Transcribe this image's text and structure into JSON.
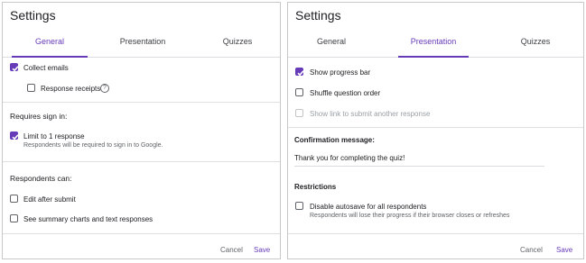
{
  "left": {
    "title": "Settings",
    "tabs": [
      "General",
      "Presentation",
      "Quizzes"
    ],
    "collect_emails": "Collect emails",
    "response_receipts": "Response receipts",
    "help_glyph": "?",
    "requires_sign_in": "Requires sign in:",
    "limit_one": "Limit to 1 response",
    "limit_one_sub": "Respondents will be required to sign in to Google.",
    "respondents_can": "Respondents can:",
    "edit_after_submit": "Edit after submit",
    "see_summary": "See summary charts and text responses",
    "cancel": "Cancel",
    "save": "Save"
  },
  "right": {
    "title": "Settings",
    "tabs": [
      "General",
      "Presentation",
      "Quizzes"
    ],
    "show_progress": "Show progress bar",
    "shuffle": "Shuffle question order",
    "show_link": "Show link to submit another response",
    "confirmation_heading": "Confirmation message:",
    "confirmation_value": "Thank you for completing the quiz!",
    "restrictions": "Restrictions",
    "disable_autosave": "Disable autosave for all respondents",
    "disable_autosave_sub": "Respondents will lose their progress if their browser closes or refreshes",
    "cancel": "Cancel",
    "save": "Save"
  },
  "state": {
    "collect_emails": true,
    "response_receipts": false,
    "limit_one": true,
    "edit_after_submit": false,
    "see_summary": false,
    "show_progress": true,
    "shuffle": false,
    "show_link": false,
    "disable_autosave": false
  },
  "colors": {
    "accent": "#673ab7",
    "text": "#202124",
    "muted": "#5f6368"
  }
}
